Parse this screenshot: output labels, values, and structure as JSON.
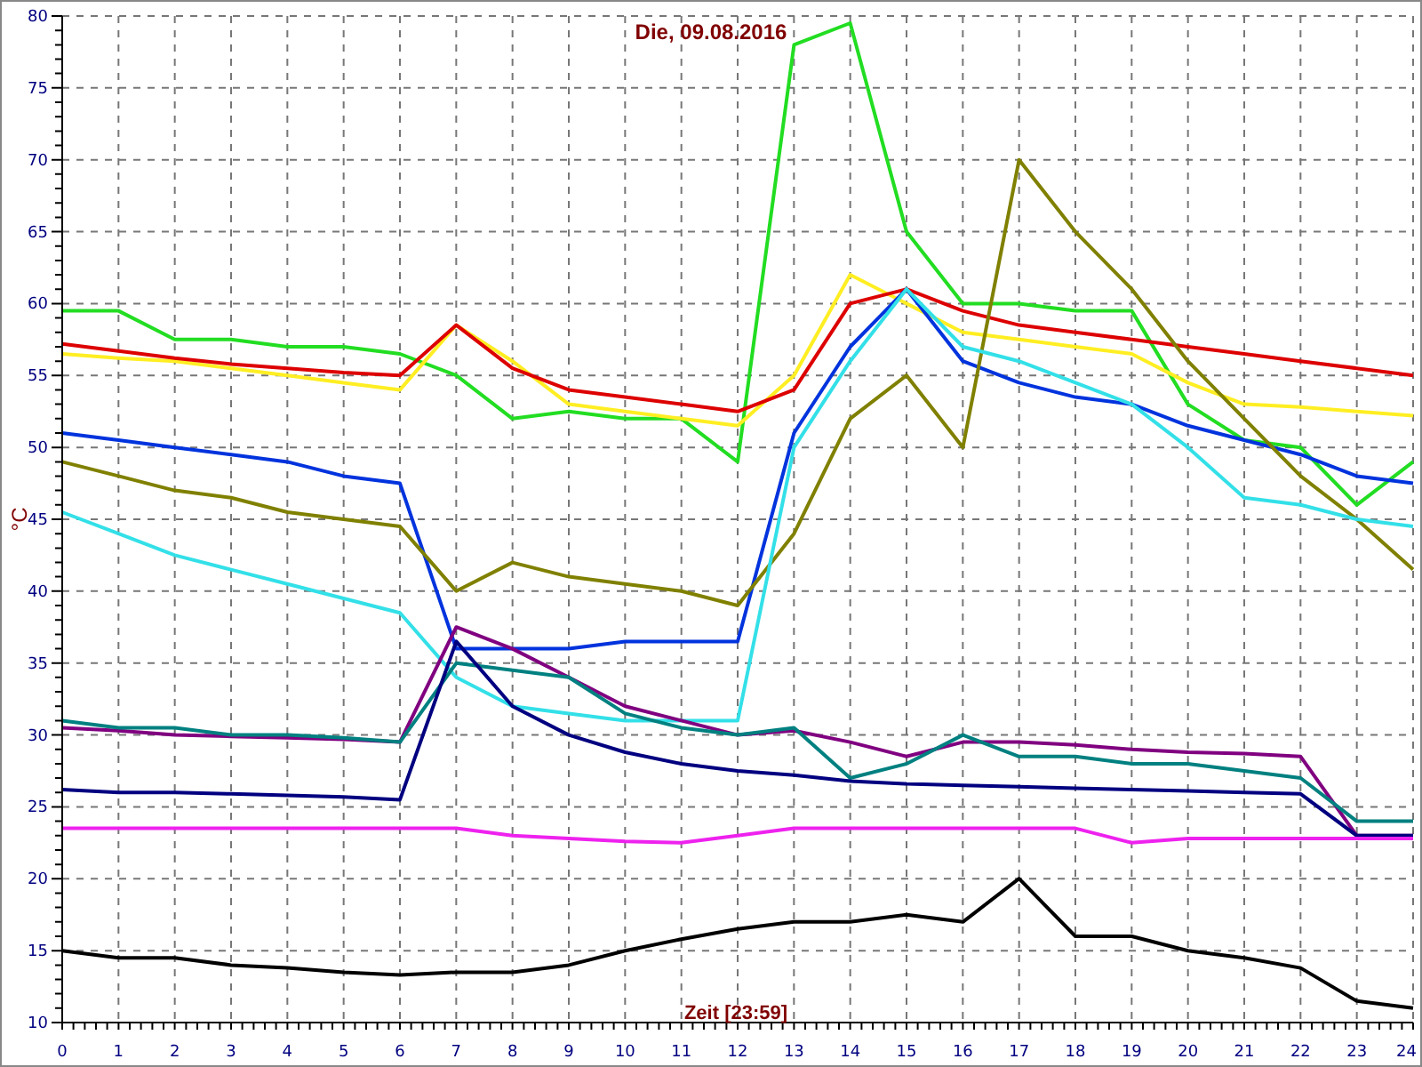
{
  "chart_data": {
    "type": "line",
    "title": "Die, 09.08.2016",
    "xlabel": "Zeit [23:59]",
    "ylabel": "°C",
    "x": [
      0,
      1,
      2,
      3,
      4,
      5,
      6,
      7,
      8,
      9,
      10,
      11,
      12,
      13,
      14,
      15,
      16,
      17,
      18,
      19,
      20,
      21,
      22,
      23,
      24
    ],
    "xlim": [
      0,
      24
    ],
    "grid": true,
    "ylim": [
      10,
      80
    ],
    "xticks": [
      0,
      1,
      2,
      3,
      4,
      5,
      6,
      7,
      8,
      9,
      10,
      11,
      12,
      13,
      14,
      15,
      16,
      17,
      18,
      19,
      20,
      21,
      22,
      23,
      24
    ],
    "yticks": [
      10,
      15,
      20,
      25,
      30,
      35,
      40,
      45,
      50,
      55,
      60,
      65,
      70,
      75,
      80
    ],
    "series": [
      {
        "color": "#22dd22",
        "values": [
          59.5,
          59.5,
          57.5,
          57.5,
          57,
          57,
          56.5,
          55,
          52,
          52.5,
          52,
          52,
          49,
          78,
          79.5,
          65,
          60,
          60,
          59.5,
          59.5,
          53,
          50.5,
          50,
          46,
          49
        ]
      },
      {
        "color": "#ffee22",
        "values": [
          56.5,
          56.2,
          56,
          55.5,
          55,
          54.5,
          54,
          58.5,
          56,
          53,
          52.5,
          52,
          51.5,
          55,
          62,
          60,
          58,
          57.5,
          57,
          56.5,
          54.5,
          53,
          52.8,
          52.5,
          52.2
        ]
      },
      {
        "color": "#dd0000",
        "values": [
          57.2,
          56.7,
          56.2,
          55.8,
          55.5,
          55.2,
          55,
          58.5,
          55.5,
          54,
          53.5,
          53,
          52.5,
          54,
          60,
          61,
          59.5,
          58.5,
          58,
          57.5,
          57,
          56.5,
          56,
          55.5,
          55
        ]
      },
      {
        "color": "#0033dd",
        "values": [
          51,
          50.5,
          50,
          49.5,
          49,
          48,
          47.5,
          36,
          36,
          36,
          36.5,
          36.5,
          36.5,
          51,
          57,
          61,
          56,
          54.5,
          53.5,
          53,
          51.5,
          50.5,
          49.5,
          48,
          47.5
        ]
      },
      {
        "color": "#808000",
        "values": [
          49,
          48,
          47,
          46.5,
          45.5,
          45,
          44.5,
          40,
          42,
          41,
          40.5,
          40,
          39,
          44,
          52,
          55,
          50,
          70,
          65,
          61,
          56,
          52,
          48,
          45,
          41.5
        ]
      },
      {
        "color": "#33e0e8",
        "values": [
          45.5,
          44,
          42.5,
          41.5,
          40.5,
          39.5,
          38.5,
          34,
          32,
          31.5,
          31,
          31,
          31,
          50,
          56,
          61,
          57,
          56,
          54.5,
          53,
          50,
          46.5,
          46,
          45,
          44.5
        ]
      },
      {
        "color": "#800080",
        "values": [
          30.5,
          30.3,
          30,
          29.9,
          29.8,
          29.7,
          29.5,
          37.5,
          36,
          34,
          32,
          31,
          30,
          30.3,
          29.5,
          28.5,
          29.5,
          29.5,
          29.3,
          29,
          28.8,
          28.7,
          28.5,
          23,
          23
        ]
      },
      {
        "color": "#008080",
        "values": [
          31,
          30.5,
          30.5,
          30,
          30,
          29.8,
          29.5,
          35,
          34.5,
          34,
          31.5,
          30.5,
          30,
          30.5,
          27,
          28,
          30,
          28.5,
          28.5,
          28,
          28,
          27.5,
          27,
          24,
          24
        ]
      },
      {
        "color": "#000080",
        "values": [
          26.2,
          26,
          26,
          25.9,
          25.8,
          25.7,
          25.5,
          36.5,
          32,
          30,
          28.8,
          28,
          27.5,
          27.2,
          26.8,
          26.6,
          26.5,
          26.4,
          26.3,
          26.2,
          26.1,
          26,
          25.9,
          23,
          23
        ]
      },
      {
        "color": "#ee22ee",
        "values": [
          23.5,
          23.5,
          23.5,
          23.5,
          23.5,
          23.5,
          23.5,
          23.5,
          23,
          22.8,
          22.6,
          22.5,
          23,
          23.5,
          23.5,
          23.5,
          23.5,
          23.5,
          23.5,
          22.5,
          22.8,
          22.8,
          22.8,
          22.8,
          22.8
        ]
      },
      {
        "color": "#000000",
        "values": [
          15,
          14.5,
          14.5,
          14,
          13.8,
          13.5,
          13.3,
          13.5,
          13.5,
          14,
          15,
          15.8,
          16.5,
          17,
          17,
          17.5,
          17,
          20,
          16,
          16,
          15,
          14.5,
          13.8,
          11.5,
          11
        ]
      }
    ]
  }
}
